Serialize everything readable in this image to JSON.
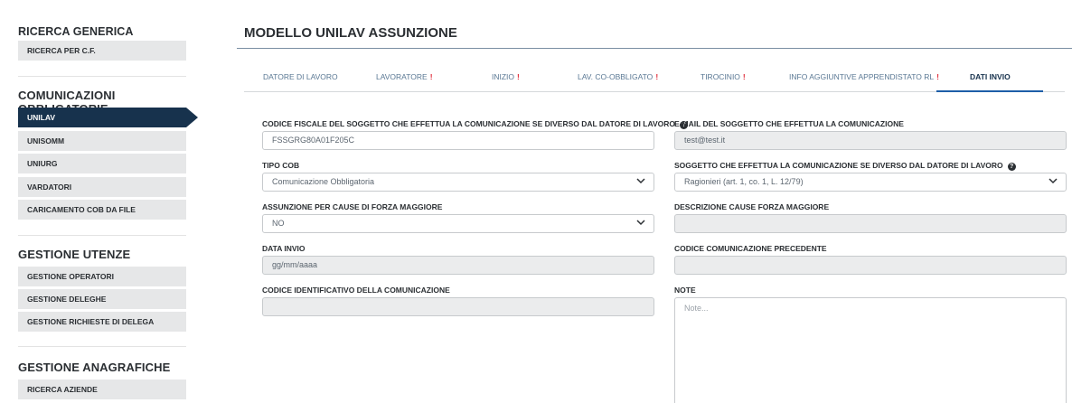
{
  "sidebar": {
    "sections": [
      {
        "title": "RICERCA GENERICA",
        "items": [
          "RICERCA PER C.F."
        ]
      },
      {
        "title": "COMUNICAZIONI OBBLIGATORIE",
        "items": [
          "UNILAV",
          "UNISOMM",
          "UNIURG",
          "VARDATORI",
          "CARICAMENTO COB DA FILE"
        ]
      },
      {
        "title": "GESTIONE UTENZE",
        "items": [
          "GESTIONE OPERATORI",
          "GESTIONE DELEGHE",
          "GESTIONE RICHIESTE DI DELEGA"
        ]
      },
      {
        "title": "GESTIONE ANAGRAFICHE",
        "items": [
          "RICERCA AZIENDE"
        ]
      }
    ],
    "active_item": "UNILAV"
  },
  "main": {
    "title": "MODELLO UNILAV ASSUNZIONE",
    "tabs": [
      {
        "label": "DATORE DI LAVORO",
        "warn": ""
      },
      {
        "label": "LAVORATORE",
        "warn": "!"
      },
      {
        "label": "INIZIO",
        "warn": "!"
      },
      {
        "label": "LAV. CO-OBBLIGATO",
        "warn": "!"
      },
      {
        "label": "TIROCINIO",
        "warn": "!"
      },
      {
        "label": "INFO AGGIUNTIVE APPRENDISTATO RL",
        "warn": "!"
      },
      {
        "label": "DATI INVIO",
        "warn": ""
      }
    ],
    "active_tab": "DATI INVIO"
  },
  "form": {
    "codice_fiscale": {
      "label": "CODICE FISCALE DEL SOGGETTO CHE EFFETTUA LA COMUNICAZIONE SE DIVERSO DAL DATORE DI LAVORO",
      "value": "FSSGRG80A01F205C"
    },
    "email": {
      "label": "E-MAIL DEL SOGGETTO CHE EFFETTUA LA COMUNICAZIONE",
      "value": "test@test.it"
    },
    "tipo_cob": {
      "label": "TIPO COB",
      "value": "Comunicazione Obbligatoria"
    },
    "soggetto": {
      "label": "SOGGETTO CHE EFFETTUA LA COMUNICAZIONE SE DIVERSO DAL DATORE DI LAVORO",
      "value": "Ragionieri (art. 1, co. 1, L. 12/79)"
    },
    "forza_maggiore": {
      "label": "ASSUNZIONE PER CAUSE DI FORZA MAGGIORE",
      "value": "NO"
    },
    "descrizione_forza": {
      "label": "DESCRIZIONE CAUSE FORZA MAGGIORE",
      "value": ""
    },
    "data_invio": {
      "label": "DATA INVIO",
      "value": "gg/mm/aaaa"
    },
    "codice_precedente": {
      "label": "CODICE COMUNICAZIONE PRECEDENTE",
      "value": ""
    },
    "codice_identificativo": {
      "label": "CODICE IDENTIFICATIVO DELLA COMUNICAZIONE",
      "value": ""
    },
    "note": {
      "label": "NOTE",
      "placeholder": "Note..."
    }
  },
  "icons": {
    "info": "info-icon",
    "chevron": "chevron-down-icon"
  }
}
